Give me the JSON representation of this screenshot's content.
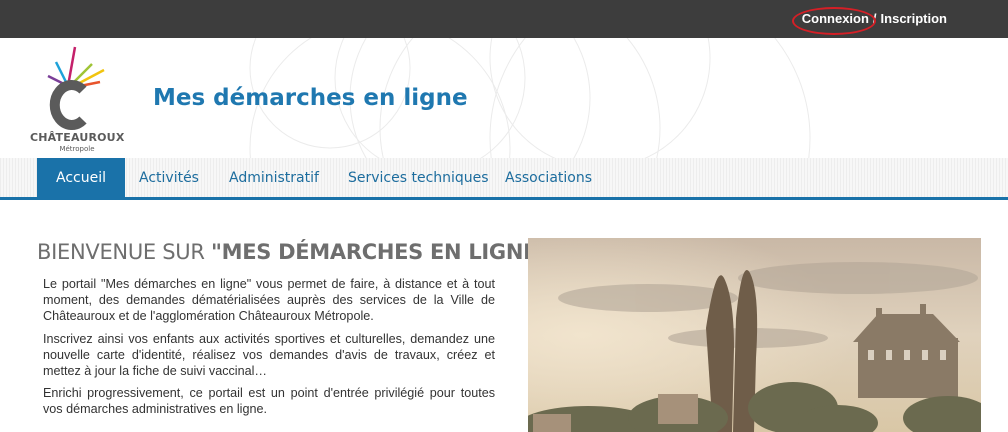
{
  "topbar": {
    "login_label": "Connexion",
    "separator": "/",
    "register_label": "Inscription"
  },
  "header": {
    "logo_name": "CHÂTEAUROUX",
    "logo_sub": "Métropole",
    "title": "Mes démarches en ligne"
  },
  "nav": {
    "items": [
      {
        "label": "Accueil",
        "active": true
      },
      {
        "label": "Activités"
      },
      {
        "label": "Administratif"
      },
      {
        "label": "Services techniques"
      },
      {
        "label": "Associations"
      }
    ]
  },
  "main": {
    "heading_prefix": "BIENVENUE SUR ",
    "heading_emphasis": "\"MES DÉMARCHES EN LIGNE\"",
    "paragraphs": [
      "Le portail \"Mes démarches en ligne\" vous permet de faire, à distance et à tout moment, des demandes dématérialisées auprès des services de la Ville de Châteauroux et de l'agglomération Châteauroux Métropole.",
      "Inscrivez ainsi vos enfants aux activités sportives et culturelles, demandez une nouvelle carte d'identité, réalisez vos demandes d'avis de travaux, créez et mettez à jour la fiche de suivi vaccinal…",
      "Enrichi progressivement, ce portail est un point d'entrée privilégié pour toutes vos démarches administratives en ligne."
    ]
  },
  "colors": {
    "brand_blue": "#1a72a9",
    "topbar": "#3d3d3d",
    "annotation_red": "#d51f26"
  }
}
